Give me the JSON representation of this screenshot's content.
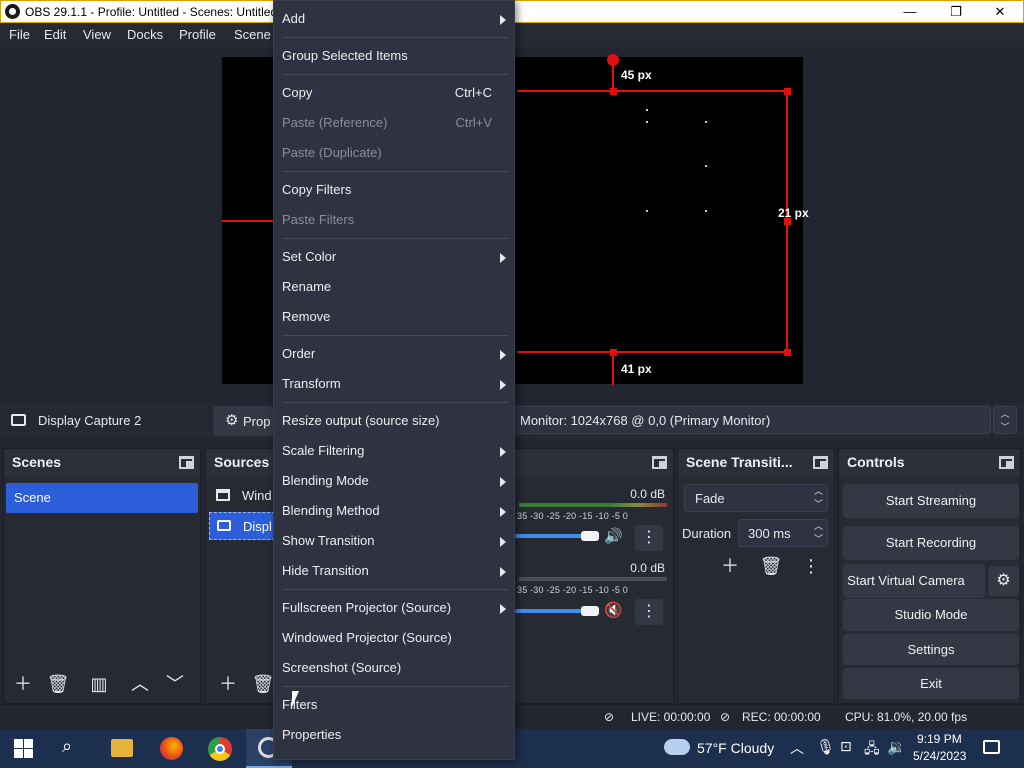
{
  "window": {
    "title": "OBS 29.1.1 - Profile: Untitled - Scenes: Untitled",
    "minimize": "—",
    "maximize": "❐",
    "close": "✕"
  },
  "menubar": [
    "File",
    "Edit",
    "View",
    "Docks",
    "Profile",
    "Scene"
  ],
  "preview": {
    "top_label": "45 px",
    "right_label": "21 px",
    "bottom_label": "41 px"
  },
  "source_toolbar": {
    "selected_source": "Display Capture 2",
    "properties_label": "Prop",
    "monitor_select": "Monitor: 1024x768 @ 0,0 (Primary Monitor)"
  },
  "scenes": {
    "title": "Scenes",
    "items": [
      "Scene"
    ]
  },
  "sources": {
    "title": "Sources",
    "items": [
      {
        "label": "Wind",
        "icon": "window-icon"
      },
      {
        "label": "Displ",
        "icon": "monitor-icon"
      }
    ]
  },
  "mixer": {
    "channels": [
      {
        "db": "0.0 dB",
        "muted": false
      },
      {
        "db": "0.0 dB",
        "muted": true
      }
    ],
    "scale": "35 -30 -25 -20 -15 -10 -5  0"
  },
  "transitions": {
    "title": "Scene Transiti...",
    "selected": "Fade",
    "duration_label": "Duration",
    "duration_value": "300 ms"
  },
  "controls": {
    "title": "Controls",
    "buttons": [
      "Start Streaming",
      "Start Recording",
      "Start Virtual Camera",
      "Studio Mode",
      "Settings",
      "Exit"
    ]
  },
  "statusbar": {
    "live": "LIVE: 00:00:00",
    "rec": "REC: 00:00:00",
    "cpu": "CPU: 81.0%, 20.00 fps"
  },
  "context_menu": {
    "items": [
      {
        "label": "Add",
        "submenu": true
      },
      {
        "sep": true
      },
      {
        "label": "Group Selected Items"
      },
      {
        "sep": true
      },
      {
        "label": "Copy",
        "shortcut": "Ctrl+C"
      },
      {
        "label": "Paste (Reference)",
        "shortcut": "Ctrl+V",
        "disabled": true
      },
      {
        "label": "Paste (Duplicate)",
        "disabled": true
      },
      {
        "sep": true
      },
      {
        "label": "Copy Filters"
      },
      {
        "label": "Paste Filters",
        "disabled": true
      },
      {
        "sep": true
      },
      {
        "label": "Set Color",
        "submenu": true
      },
      {
        "label": "Rename"
      },
      {
        "label": "Remove"
      },
      {
        "sep": true
      },
      {
        "label": "Order",
        "submenu": true
      },
      {
        "label": "Transform",
        "submenu": true
      },
      {
        "sep": true
      },
      {
        "label": "Resize output (source size)"
      },
      {
        "label": "Scale Filtering",
        "submenu": true
      },
      {
        "label": "Blending Mode",
        "submenu": true
      },
      {
        "label": "Blending Method",
        "submenu": true
      },
      {
        "label": "Show Transition",
        "submenu": true
      },
      {
        "label": "Hide Transition",
        "submenu": true
      },
      {
        "sep": true
      },
      {
        "label": "Fullscreen Projector (Source)",
        "submenu": true
      },
      {
        "label": "Windowed Projector (Source)"
      },
      {
        "label": "Screenshot (Source)"
      },
      {
        "sep": true
      },
      {
        "label": "Filters"
      },
      {
        "label": "Properties"
      }
    ]
  },
  "taskbar": {
    "weather": "57°F  Cloudy",
    "time": "9:19 PM",
    "date": "5/24/2023"
  },
  "colors": {
    "accent": "#2b5ed8",
    "handle_red": "#e01010",
    "background": "#232530"
  }
}
